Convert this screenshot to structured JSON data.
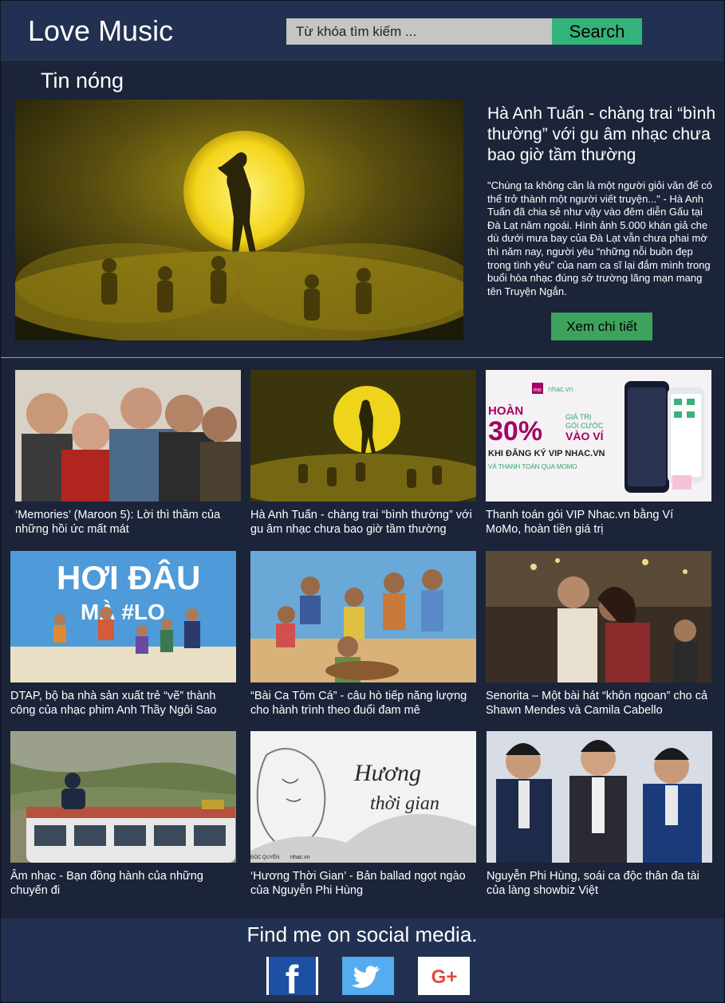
{
  "header": {
    "logo": "Love Music",
    "search_placeholder": "Từ khóa tìm kiếm ...",
    "search_button": "Search"
  },
  "hot_news": {
    "section_title": "Tin nóng",
    "title": "Hà Anh Tuấn - chàng trai “bình thường” với gu âm nhạc chưa bao giờ tầm thường",
    "excerpt": "\"Chúng ta không cần là một người giỏi văn để có thể trở thành một người viết truyện...\" - Hà Anh Tuấn đã chia sẻ như vậy vào đêm diễn Gấu tại Đà Lạt năm ngoái. Hình ảnh 5.000 khán giả che dù dưới mưa bay của Đà Lạt vẫn chưa phai mờ thì năm nay, người yêu “những nỗi buồn đẹp trong tình yêu” của nam ca sĩ lại đắm mình trong buổi hòa nhạc đúng sở trường lãng mạn mang tên Truyện Ngắn.",
    "detail_button": "Xem chi tiết"
  },
  "articles": [
    {
      "title": "‘Memories’ (Maroon 5): Lời thì thầm của những hồi ức mất mát"
    },
    {
      "title": "Hà Anh Tuấn - chàng trai “bình thường” với gu âm nhạc chưa bao giờ tầm thường"
    },
    {
      "title": "Thanh toán gói VIP Nhac.vn bằng Ví MoMo, hoàn tiền giá trị"
    },
    {
      "title": "DTAP, bộ ba nhà sản xuất trẻ “vẽ” thành công của nhạc phim Anh Thầy Ngôi Sao"
    },
    {
      "title": "“Bài Ca Tôm Cá” - câu hò tiếp năng lượng cho hành trình theo đuổi đam mê"
    },
    {
      "title": "Senorita – Một bài hát “khôn ngoan” cho cả Shawn Mendes và Camila Cabello"
    },
    {
      "title": "Âm nhạc - Bạn đồng hành của những chuyến đi"
    },
    {
      "title": "‘Hương Thời Gian’ - Bản ballad ngọt ngào của Nguyễn Phi Hùng"
    },
    {
      "title": "Nguyễn Phi Hùng, soái ca độc thân đa tài của làng showbiz Việt"
    }
  ],
  "momo_banner": {
    "brand_momo": "mo mo",
    "brand_nhac": "nhac.vn",
    "headline": "HOÀN",
    "percent": "30%",
    "side_line1": "GIÁ TRỊ",
    "side_line2": "GÓI CƯỚC",
    "side_line3": "VÀO VÍ",
    "subline": "KHI ĐĂNG KÝ VIP NHAC.VN",
    "subline2": "VÀ THANH TOÁN QUA MOMO"
  },
  "poster_hoi_dau": {
    "line1": "HƠI ĐÂU",
    "line2": "MÀ #LO"
  },
  "poster_huong": {
    "line1": "Hương",
    "line2": "thời gian",
    "footer_left": "ĐỘC QUYỀN",
    "footer_right": "nhac.vn"
  },
  "footer": {
    "heading": "Find me on social media.",
    "facebook_glyph": "f",
    "google_glyph": "G+"
  },
  "colors": {
    "page_bg": "#1b2439",
    "header_bg": "#223151",
    "search_button": "#33b37a",
    "detail_button": "#3da35c",
    "facebook": "#1d4fa3",
    "twitter": "#55acee",
    "google": "#dd4b39"
  },
  "icons": [
    "facebook-icon",
    "twitter-icon",
    "google-plus-icon"
  ]
}
